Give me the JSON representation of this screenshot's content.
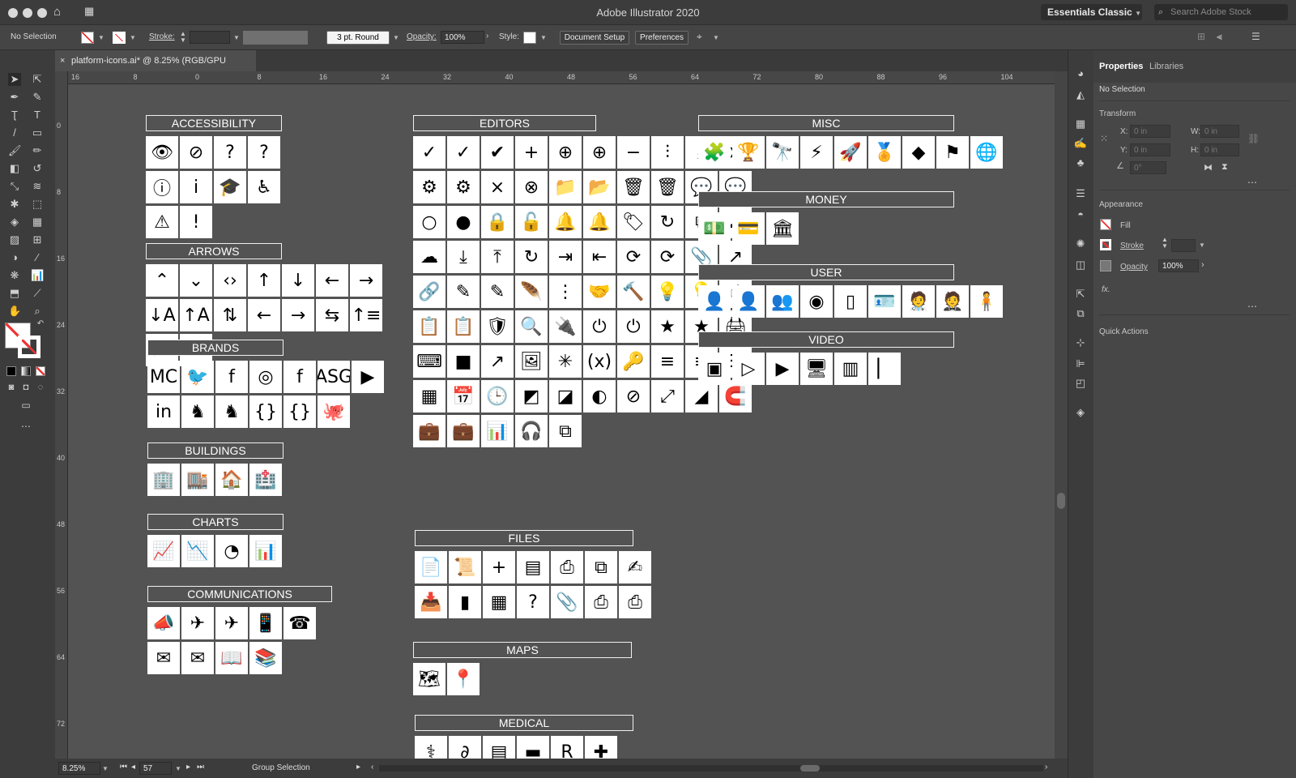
{
  "window": {
    "title": "Adobe Illustrator 2020"
  },
  "workspace": {
    "label": "Essentials Classic"
  },
  "search": {
    "placeholder": "Search Adobe Stock"
  },
  "controlbar": {
    "selection_label": "No Selection",
    "stroke_label": "Stroke:",
    "brush_value": "3 pt. Round",
    "opacity_label": "Opacity:",
    "opacity_value": "100%",
    "style_label": "Style:",
    "document_setup": "Document Setup",
    "preferences": "Preferences"
  },
  "document_tab": {
    "label": "platform-icons.ai* @ 8.25% (RGB/GPU Preview)"
  },
  "hruler_ticks": [
    "16",
    "8",
    "0",
    "8",
    "16",
    "24",
    "32",
    "40",
    "48",
    "56",
    "64",
    "72",
    "80",
    "88",
    "96",
    "104"
  ],
  "vruler_ticks": [
    "0",
    "8",
    "16",
    "24",
    "32",
    "40",
    "48",
    "56",
    "64",
    "72"
  ],
  "status": {
    "zoom": "8.25%",
    "page": "57",
    "tool": "Group Selection"
  },
  "properties_panel": {
    "tabs": [
      "Properties",
      "Libraries"
    ],
    "selection": "No Selection",
    "transform_title": "Transform",
    "x_label": "X:",
    "y_label": "Y:",
    "w_label": "W:",
    "h_label": "H:",
    "x_value": "0 in",
    "y_value": "0 in",
    "w_value": "0 in",
    "h_value": "0 in",
    "angle_value": "0°",
    "appearance_title": "Appearance",
    "fill_label": "Fill",
    "stroke_label": "Stroke",
    "opacity_label": "Opacity",
    "opacity_value": "100%",
    "fx_label": "fx.",
    "quick_actions": "Quick Actions"
  },
  "sections": {
    "accessibility": {
      "title": "ACCESSIBILITY",
      "icons": [
        "👁",
        "⊘",
        "?",
        "?",
        "ⓘ",
        "i",
        "🎓",
        "♿",
        "⚠",
        "!"
      ]
    },
    "arrows": {
      "title": "ARROWS",
      "icons": [
        "⌃",
        "⌄",
        "‹›",
        "↑",
        "↓",
        "←",
        "→",
        "↓A",
        "↑A",
        "⇅",
        "←",
        "→",
        "⇆",
        "↑≡",
        "↓≡",
        "↙"
      ]
    },
    "brands": {
      "title": "BRANDS",
      "icons": [
        "MC",
        "🐦",
        "f",
        "◎",
        "f",
        "ASG",
        "▶",
        "in",
        "♞",
        "♞",
        "{}",
        "{}",
        "🐙"
      ]
    },
    "buildings": {
      "title": "BUILDINGS",
      "icons": [
        "🏢",
        "🏬",
        "🏠",
        "🏥"
      ]
    },
    "charts": {
      "title": "CHARTS",
      "icons": [
        "📈",
        "📉",
        "◔",
        "📊"
      ]
    },
    "communications": {
      "title": "COMMUNICATIONS",
      "icons": [
        "📣",
        "✈",
        "✈",
        "📱",
        "☎",
        "✉",
        "✉",
        "📖",
        "📚"
      ]
    },
    "editors": {
      "title": "EDITORS",
      "icons": [
        "✓",
        "✓",
        "✔",
        "+",
        "⊕",
        "⊕",
        "−",
        "⫶",
        "⤓",
        "➤",
        "⚙",
        "⚙",
        "×",
        "⊗",
        "📁",
        "📂",
        "🗑",
        "🗑",
        "💬",
        "💬",
        "○",
        "●",
        "🔒",
        "🔓",
        "🔔",
        "🔔",
        "🏷",
        "↻",
        "⧉",
        "☁",
        "☁",
        "⤓",
        "⤒",
        "↻",
        "⇥",
        "⇤",
        "⟳",
        "⟳",
        "📎",
        "↗",
        "🔗",
        "✎",
        "✎",
        "🪶",
        "⋮",
        "🤝",
        "🔨",
        "💡",
        "💡",
        "☝",
        "📋",
        "📋",
        "🛡",
        "🔍",
        "🔌",
        "⏻",
        "⏻",
        "★",
        "★",
        "🖨",
        "⌨",
        "■",
        "↗",
        "🖼",
        "✳",
        "(x)",
        "🔑",
        "≡",
        "≡",
        "☰",
        "▦",
        "📅",
        "🕒",
        "◩",
        "◪",
        "◐",
        "⊘",
        "⤢",
        "◢",
        "🧲",
        "💼",
        "💼",
        "📊",
        "🎧",
        "⧉"
      ]
    },
    "files": {
      "title": "FILES",
      "icons": [
        "📄",
        "📜",
        "+",
        "▤",
        "⎙",
        "⧉",
        "✍",
        "📥",
        "▮",
        "▦",
        "?",
        "📎",
        "⎙",
        "⎙"
      ]
    },
    "maps": {
      "title": "MAPS",
      "icons": [
        "🗺",
        "📍"
      ]
    },
    "medical": {
      "title": "MEDICAL",
      "icons": [
        "⚕",
        "∂",
        "▤",
        "▬",
        "R",
        "✚"
      ]
    },
    "misc": {
      "title": "MISC",
      "icons": [
        "🧩",
        "🏆",
        "🔭",
        "⚡",
        "🚀",
        "🏅",
        "◆",
        "⚑",
        "🌐"
      ]
    },
    "money": {
      "title": "MONEY",
      "icons": [
        "💵",
        "💳",
        "🏛"
      ]
    },
    "user": {
      "title": "USER",
      "icons": [
        "👤",
        "👤",
        "👥",
        "◉",
        "▯",
        "🪪",
        "🧑‍⚕",
        "🤵",
        "🧍"
      ]
    },
    "video": {
      "title": "VIDEO",
      "icons": [
        "▣",
        "▷",
        "▶",
        "🖥",
        "▥",
        "▏"
      ]
    }
  }
}
